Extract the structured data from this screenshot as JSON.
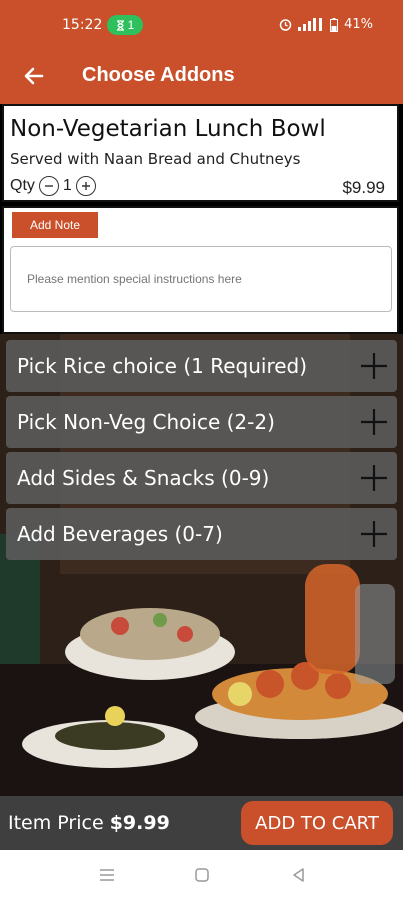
{
  "status_bar": {
    "time": "15:22",
    "notification_count": "1",
    "battery": "41%"
  },
  "app_bar": {
    "title": "Choose Addons"
  },
  "item": {
    "name": "Non-Vegetarian Lunch Bowl",
    "description": "Served with Naan Bread and Chutneys",
    "qty_label": "Qty",
    "qty_value": "1",
    "price": "$9.99"
  },
  "note": {
    "button_label": "Add Note",
    "placeholder": "Please mention special instructions here"
  },
  "sections": [
    {
      "label": "Pick Rice choice (1 Required)"
    },
    {
      "label": "Pick Non-Veg Choice (2-2)"
    },
    {
      "label": "Add Sides & Snacks (0-9)"
    },
    {
      "label": "Add Beverages (0-7)"
    }
  ],
  "footer": {
    "item_price_label": "Item Price",
    "item_price_value": "$9.99",
    "add_to_cart": "ADD TO CART"
  },
  "colors": {
    "brand": "#c9502a",
    "section_bg": "#5a5a5a",
    "footer_bg": "#3f3f3f"
  }
}
